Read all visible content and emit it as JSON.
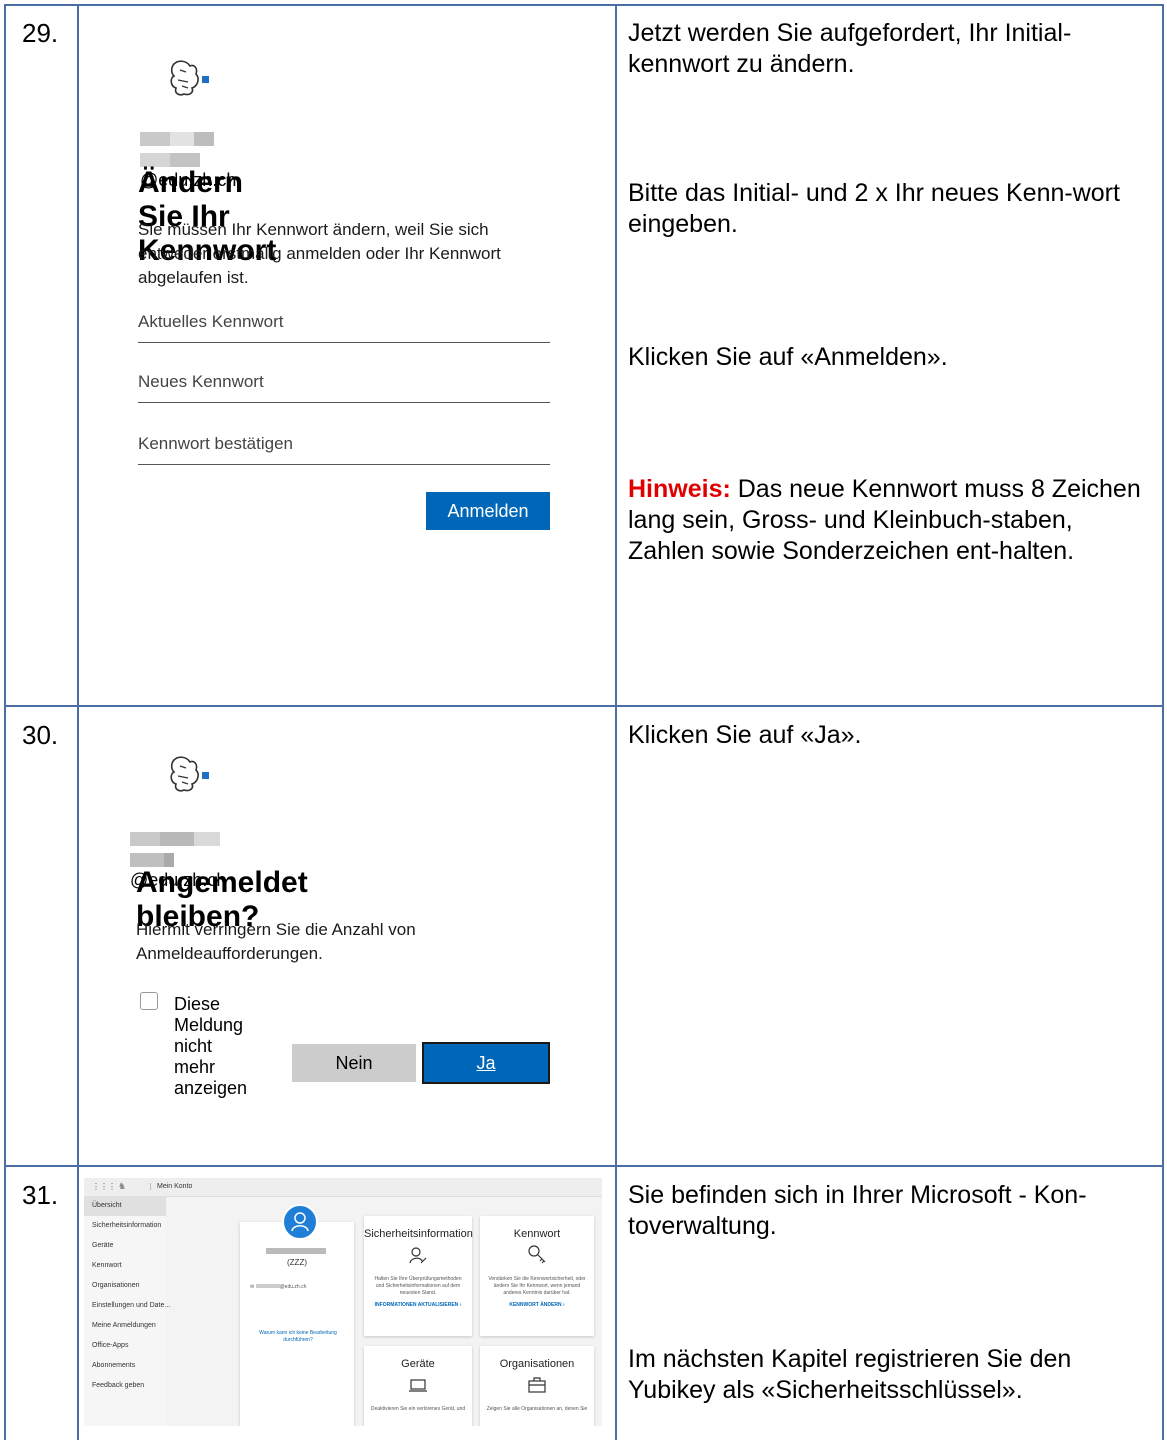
{
  "rows": [
    {
      "number": "29.",
      "screenshot": {
        "email_domain": "@edu.zh.ch",
        "heading": "Ändern Sie Ihr Kennwort",
        "description": "Sie müssen Ihr Kennwort ändern, weil Sie sich entweder erstmalig anmelden oder Ihr Kennwort abgelaufen ist.",
        "current_password_placeholder": "Aktuelles Kennwort",
        "new_password_placeholder": "Neues Kennwort",
        "confirm_password_placeholder": "Kennwort bestätigen",
        "submit_label": "Anmelden"
      },
      "instructions": {
        "p1": "Jetzt werden Sie aufgefordert, Ihr Initial-kennwort zu ändern.",
        "p2": "Bitte das Initial- und 2 x Ihr neues Kenn-wort eingeben.",
        "p3": "Klicken Sie auf «Anmelden».",
        "hint_label": "Hinweis:",
        "hint_text": " Das neue Kennwort muss 8 Zeichen lang sein, Gross- und Kleinbuch-staben, Zahlen sowie Sonderzeichen ent-halten."
      }
    },
    {
      "number": "30.",
      "screenshot": {
        "email_domain": "@edu.zh.ch",
        "heading": "Angemeldet bleiben?",
        "description": "Hiermit verringern Sie die Anzahl von Anmeldeaufforderungen.",
        "checkbox_label": "Diese Meldung nicht mehr anzeigen",
        "no_label": "Nein",
        "yes_label": "Ja"
      },
      "instructions": {
        "p1": "Klicken Sie auf «Ja»."
      }
    },
    {
      "number": "31.",
      "screenshot": {
        "app_title": "Mein Konto",
        "sidebar": [
          "Übersicht",
          "Sicherheitsinformation",
          "Geräte",
          "Kennwort",
          "Organisationen",
          "Einstellungen und Date...",
          "Meine Anmeldungen",
          "Office-Apps",
          "Abonnements",
          "Feedback geben"
        ],
        "profile_tag": "(ZZZ)",
        "profile_email": "@edu.zh.ch",
        "profile_help": "Warum kann ich keine Bearbeitung durchführen?",
        "cards": [
          {
            "title": "Sicherheitsinformation",
            "text": "Halten Sie Ihre Überprüfungsmethoden und Sicherheitsinformationen auf dem neuesten Stand.",
            "link": "INFORMATIONEN AKTUALISIEREN ›"
          },
          {
            "title": "Kennwort",
            "text": "Verstärken Sie die Kennwortsicherheit, oder ändern Sie Ihr Kennwort, wenn jemand anderes Kenntnis darüber hat.",
            "link": "KENNWORT ÄNDERN ›"
          },
          {
            "title": "Geräte",
            "text": "Deaktivieren Sie ein verlorenes Gerät, und",
            "link": ""
          },
          {
            "title": "Organisationen",
            "text": "Zeigen Sie alle Organisationen an, denen Sie",
            "link": ""
          }
        ]
      },
      "instructions": {
        "p1": "Sie befinden sich in Ihrer Microsoft - Kon-toverwaltung.",
        "p2": "Im nächsten Kapitel registrieren Sie den Yubikey als «Sicherheitsschlüssel»."
      }
    }
  ],
  "colors": {
    "border": "#4a6fa5",
    "primary_button": "#0067b8",
    "hint": "#e00000"
  }
}
